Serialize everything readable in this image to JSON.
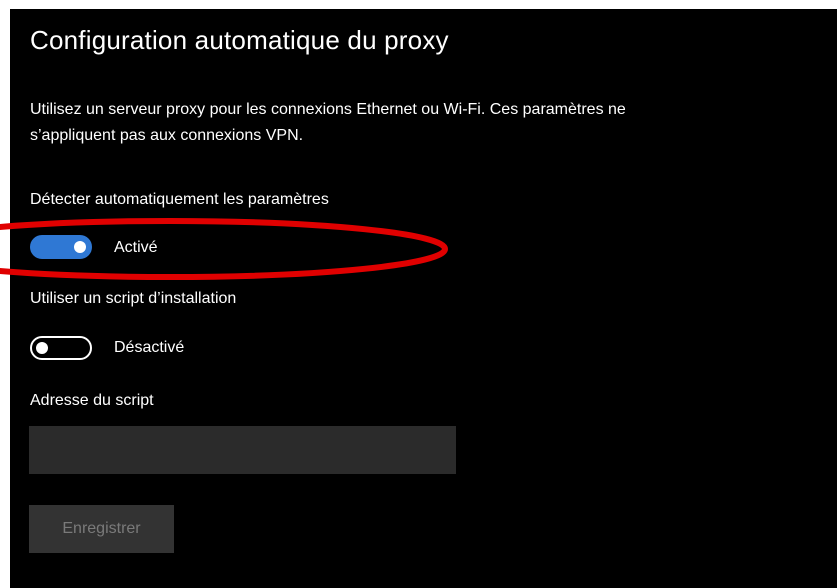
{
  "page": {
    "title": "Configuration automatique du proxy",
    "description": "Utilisez un serveur proxy pour les connexions Ethernet ou Wi-Fi. Ces paramètres ne s’appliquent pas aux connexions VPN."
  },
  "auto_detect": {
    "label": "Détecter automatiquement les paramètres",
    "state": "on",
    "state_label": "Activé"
  },
  "setup_script": {
    "label": "Utiliser un script d’installation",
    "state": "off",
    "state_label": "Désactivé"
  },
  "script_address": {
    "label": "Adresse du script",
    "value": ""
  },
  "save_button": {
    "label": "Enregistrer",
    "enabled": false
  },
  "colors": {
    "background": "#000000",
    "accent": "#2f78d4",
    "highlight_annotation": "#e00000",
    "input_background": "#2b2b2b",
    "disabled_button": "#333333"
  }
}
